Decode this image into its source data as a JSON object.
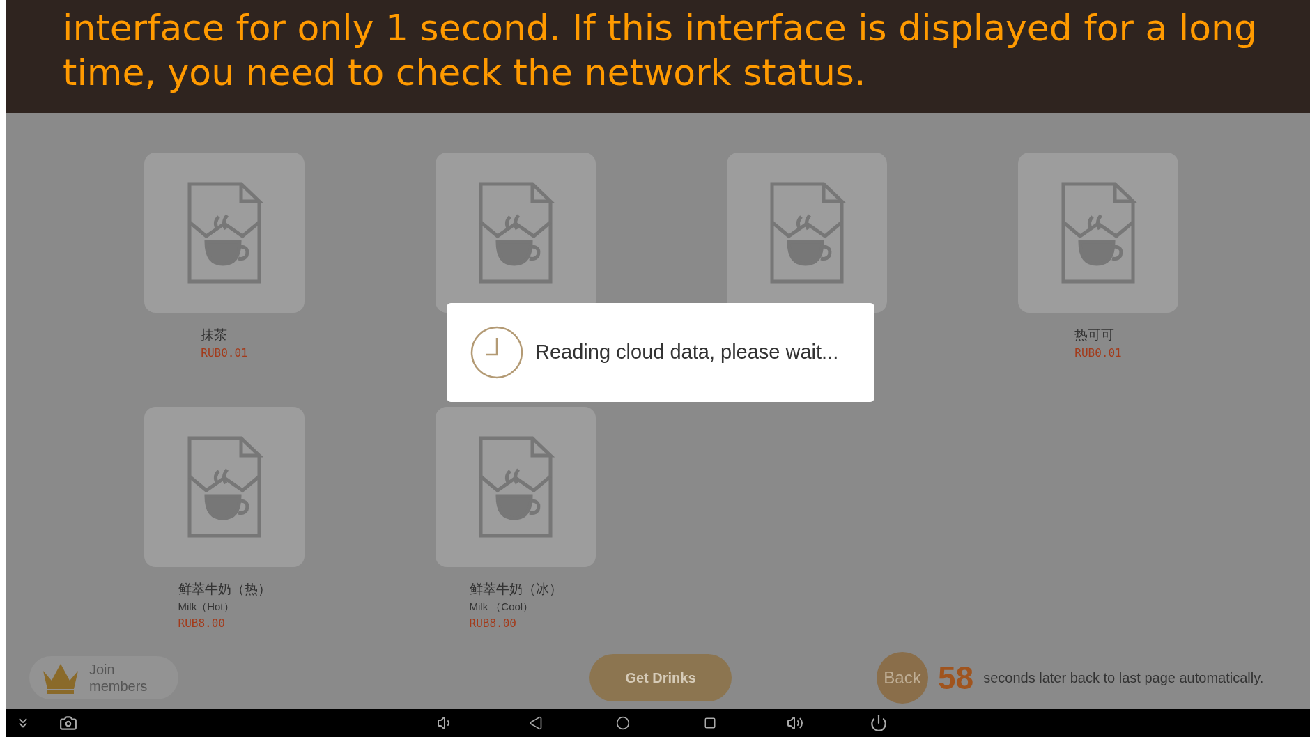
{
  "annotation": {
    "text": "interface for only 1 second. If this interface is displayed for a long time, you need to check the network status."
  },
  "products": [
    {
      "kind": "labeled",
      "name": "抹茶",
      "price": "RUB0.01"
    },
    {
      "kind": "image_only"
    },
    {
      "kind": "image_only"
    },
    {
      "kind": "labeled",
      "name": "热可可",
      "price": "RUB0.01"
    },
    {
      "kind": "labeled",
      "name": "鲜萃牛奶（热）",
      "subtitle": "Milk（Hot）",
      "price": "RUB8.00"
    },
    {
      "kind": "labeled",
      "name": "鲜萃牛奶（冰）",
      "subtitle": "Milk （Cool）",
      "price": "RUB8.00"
    }
  ],
  "dialog": {
    "message": "Reading cloud data, please wait..."
  },
  "footer": {
    "join": "Join members",
    "get_drinks": "Get Drinks",
    "back": "Back",
    "countdown": "58",
    "countdown_text": "seconds later back to last page automatically."
  }
}
